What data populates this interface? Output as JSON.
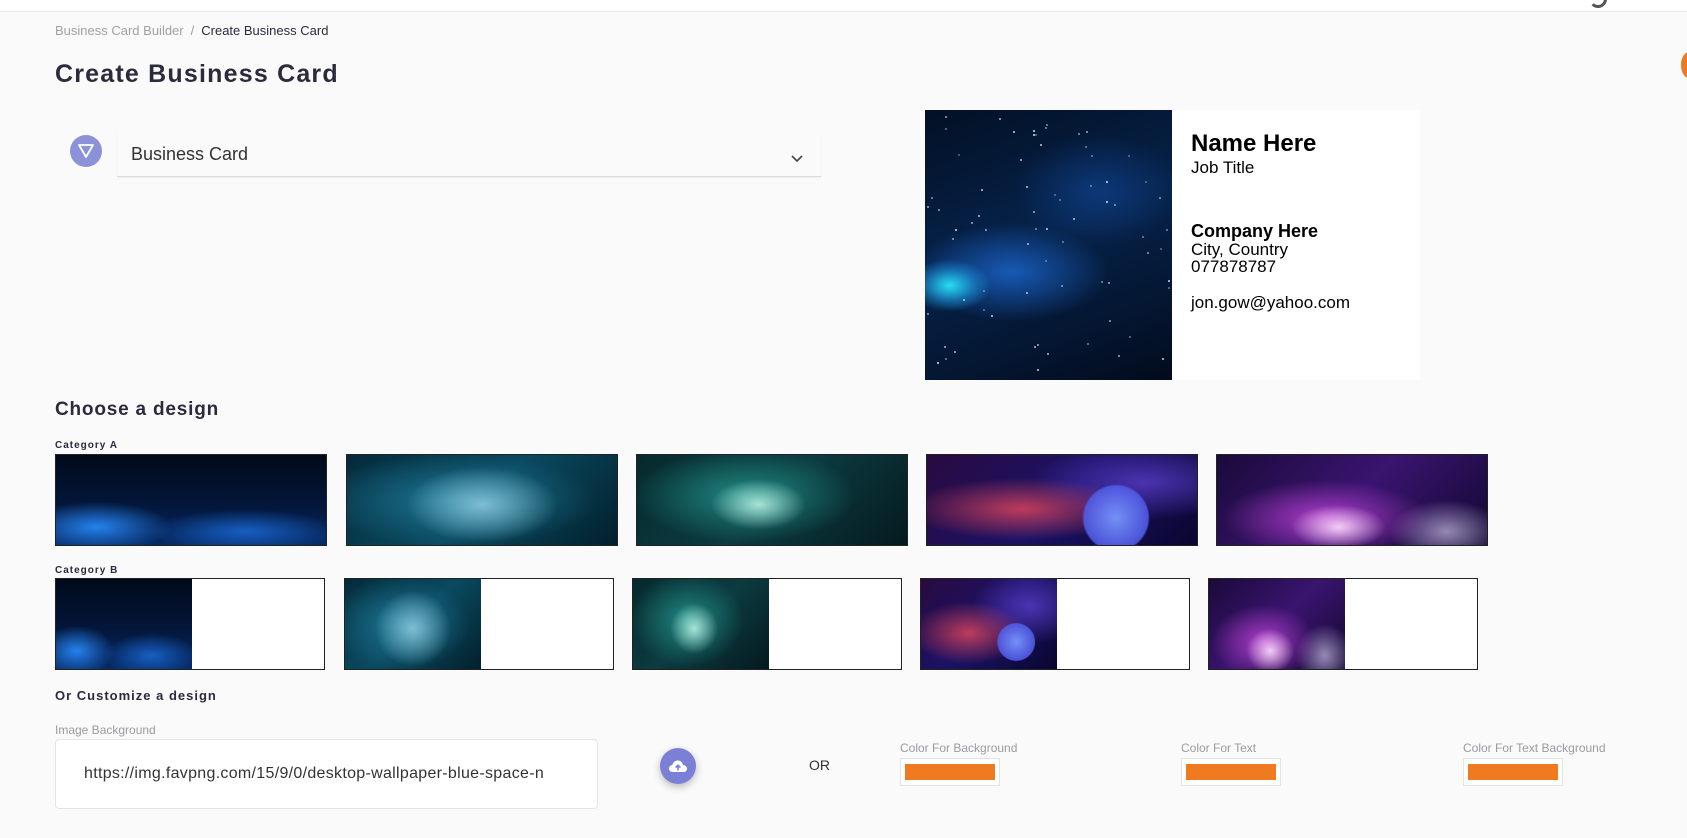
{
  "breadcrumb": {
    "parent": "Business Card Builder",
    "separator": "/",
    "current": "Create Business Card"
  },
  "page_title": "Create Business Card",
  "card_type": {
    "icon": "triangle-down-icon",
    "selected": "Business Card"
  },
  "card_preview": {
    "name": "Name Here",
    "job_title": "Job Title",
    "company": "Company Here",
    "city": "City, Country",
    "phone": "077878787",
    "email": "jon.gow@yahoo.com"
  },
  "designs": {
    "title": "Choose a design",
    "category_a": "Category A",
    "category_b": "Category B",
    "items": [
      "blue-nebula",
      "teal-cloud",
      "green-starfield",
      "pink-planet",
      "purple-galaxy"
    ]
  },
  "customize": {
    "title": "Or Customize a design",
    "image_label": "Image Background",
    "image_url": "https://img.favpng.com/15/9/0/desktop-wallpaper-blue-space-n",
    "or_label": "OR",
    "bg_color_label": "Color For Background",
    "text_color_label": "Color For Text",
    "text_bg_color_label": "Color For Text Background",
    "bg_color": "#f07a1f",
    "text_color": "#f07a1f",
    "text_bg_color": "#f07a1f"
  },
  "colors": {
    "accent": "#8b92d8",
    "button": "#7b80d6"
  }
}
